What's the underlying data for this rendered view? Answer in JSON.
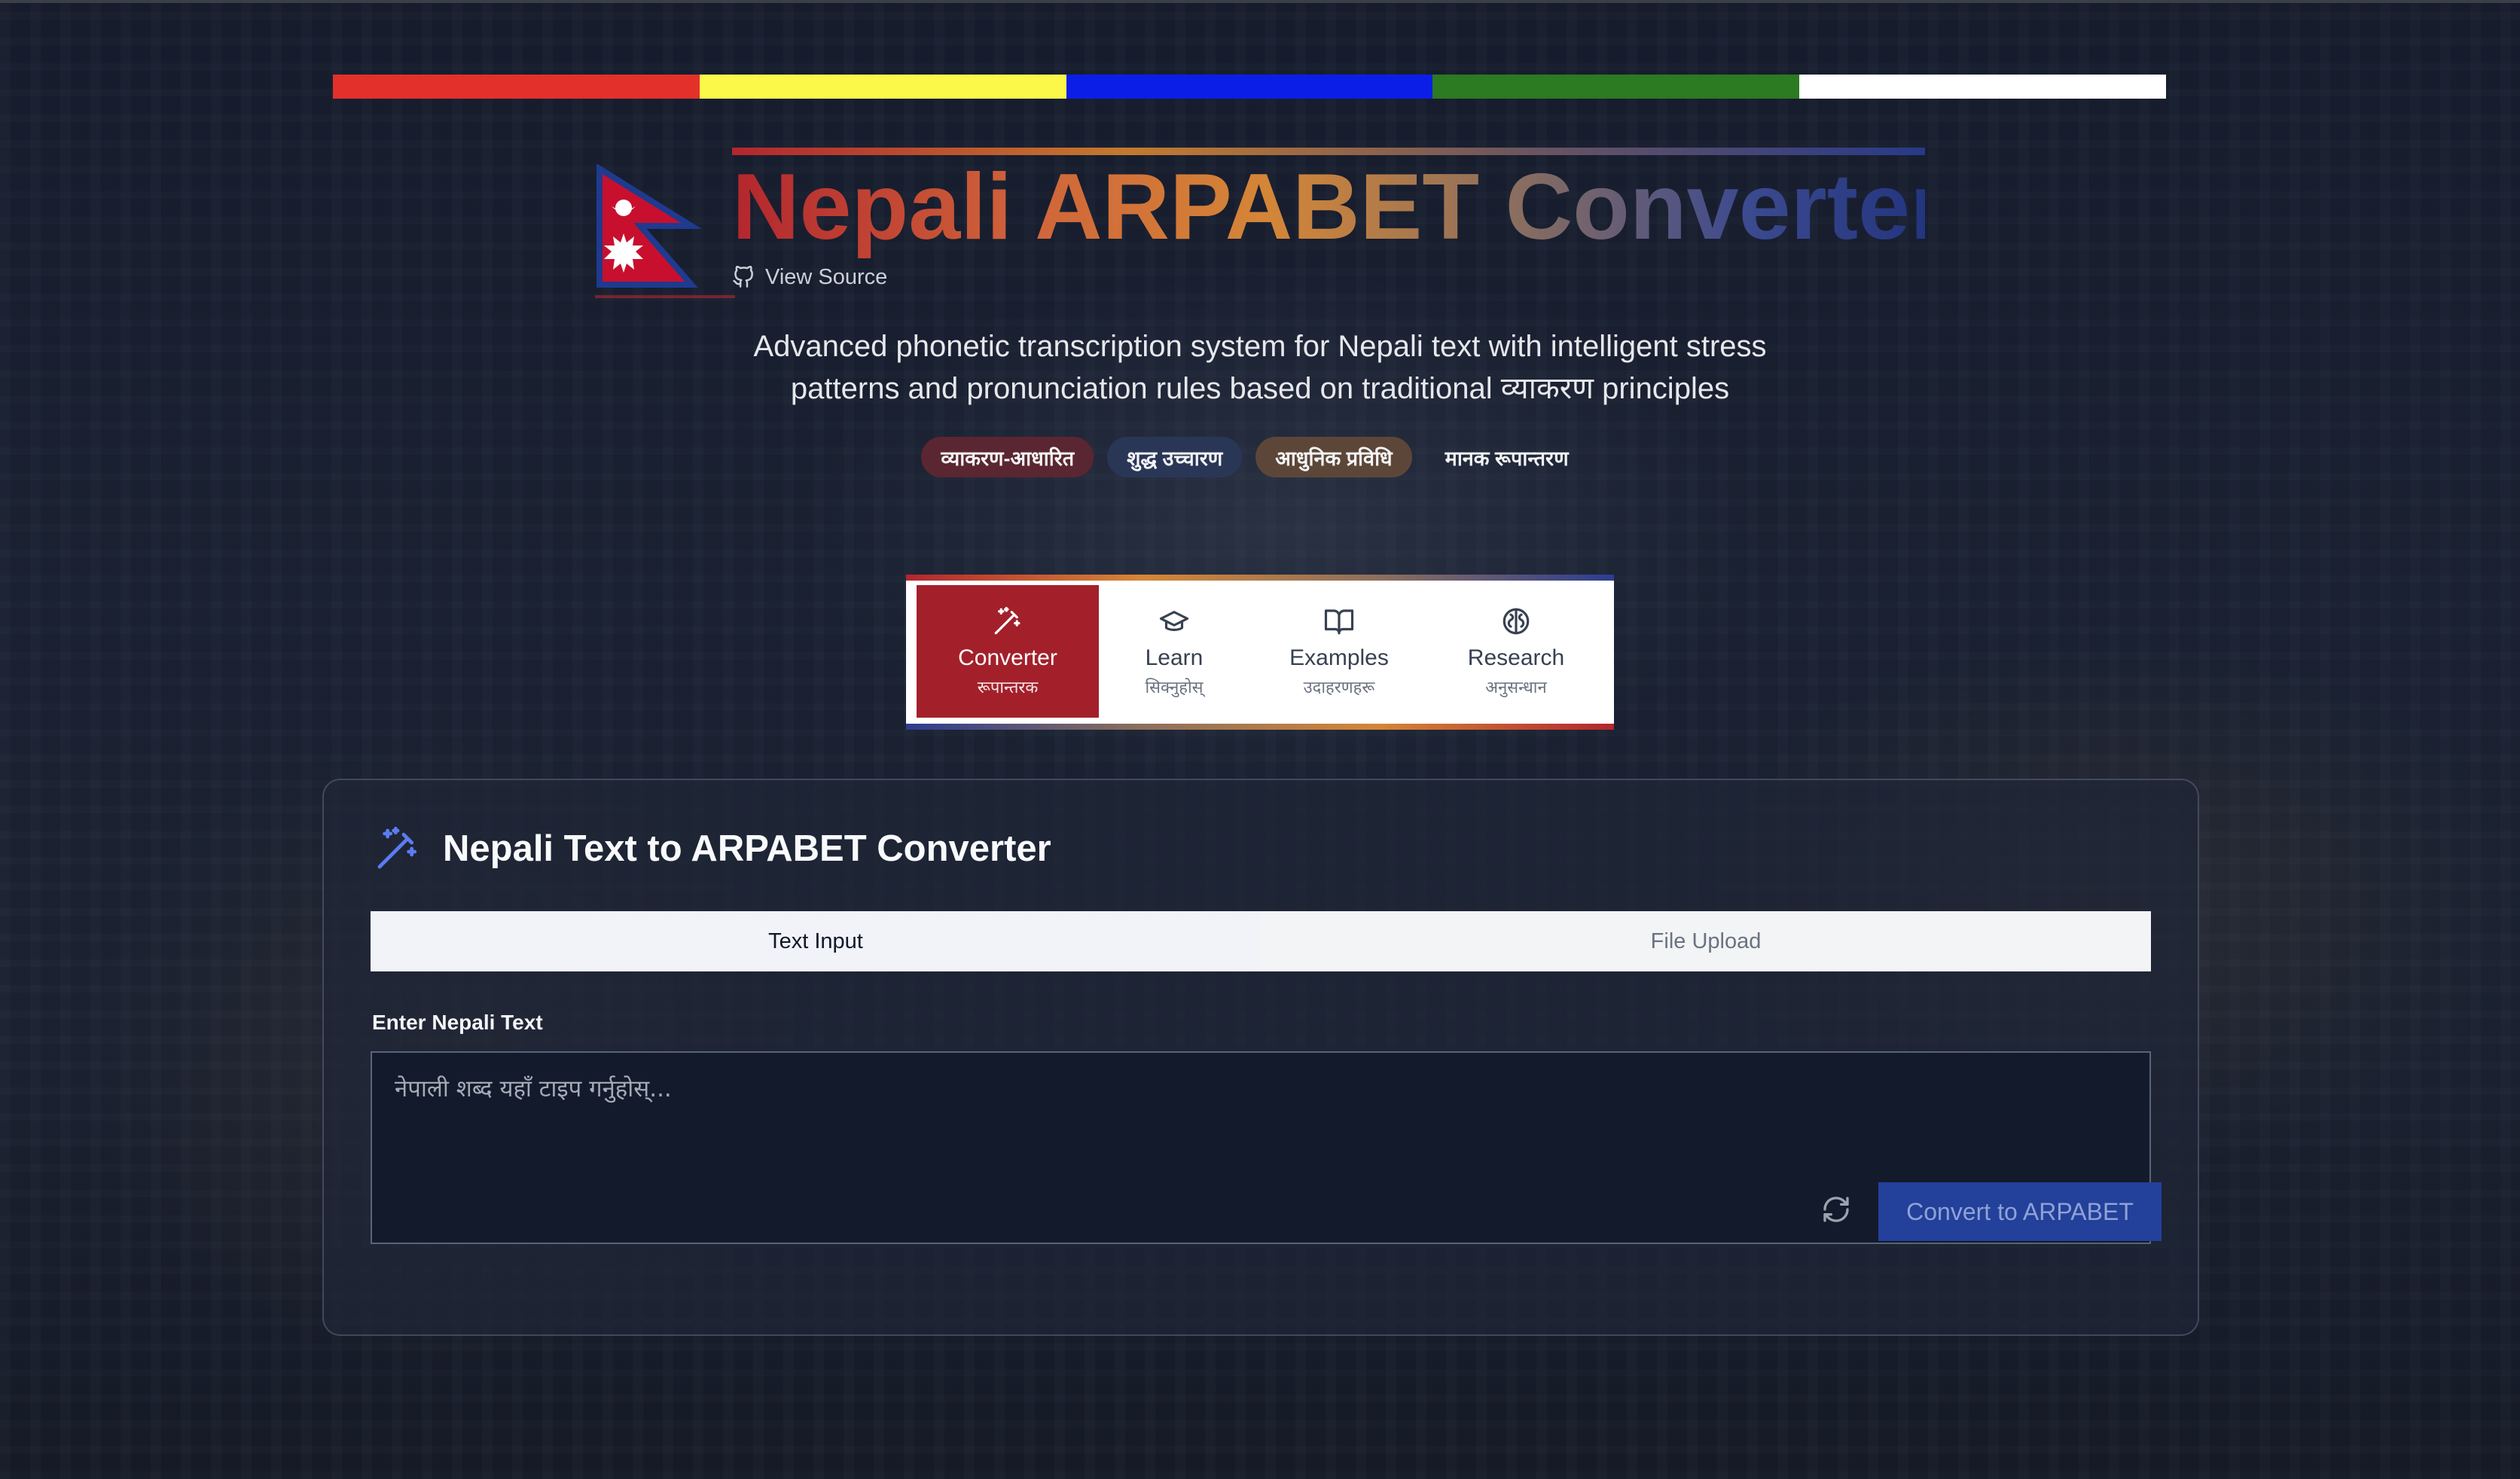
{
  "colors": {
    "flag_red": "#dc3126",
    "flag_yellow": "#fbf74a",
    "flag_blue": "#0a1fe6",
    "flag_green": "#2a7a1f",
    "flag_white": "#ffffff",
    "crimson": "#a3202b",
    "navy": "#23409a"
  },
  "flag_stripes": [
    "#e3302a",
    "#fcf84a",
    "#0b1ee8",
    "#2c7a21",
    "#ffffff"
  ],
  "header": {
    "logo_icon": "nepal-flag-icon",
    "title": "Nepali ARPABET Converter",
    "view_source_icon": "github-icon",
    "view_source_label": "View Source",
    "subtitle_line1": "Advanced phonetic transcription system for Nepali text with intelligent stress",
    "subtitle_line2": "patterns and pronunciation rules based on traditional व्याकरण principles"
  },
  "badges": [
    {
      "label": "व्याकरण-आधारित",
      "bg": "#5a2631"
    },
    {
      "label": "शुद्ध उच्चारण",
      "bg": "#2a3656"
    },
    {
      "label": "आधुनिक प्रविधि",
      "bg": "#5c4638"
    },
    {
      "label": "मानक रूपान्तरण",
      "bg": "rgba(0,0,0,0)"
    }
  ],
  "nav": {
    "items": [
      {
        "label": "Converter",
        "sub": "रूपान्तरक",
        "icon": "magic-wand-icon"
      },
      {
        "label": "Learn",
        "sub": "सिक्नुहोस्",
        "icon": "graduation-cap-icon"
      },
      {
        "label": "Examples",
        "sub": "उदाहरणहरू",
        "icon": "book-open-icon"
      },
      {
        "label": "Research",
        "sub": "अनुसन्धान",
        "icon": "brain-icon"
      }
    ],
    "active": "Converter"
  },
  "converter": {
    "title_icon": "magic-wand-icon",
    "title": "Nepali Text to ARPABET Converter",
    "tabs": [
      {
        "label": "Text Input",
        "active": true
      },
      {
        "label": "File Upload",
        "active": false
      }
    ],
    "field_label": "Enter Nepali Text",
    "placeholder": "नेपाली शब्द यहाँ टाइप गर्नुहोस्...",
    "value": "",
    "reset_icon": "refresh-icon",
    "convert_label": "Convert to ARPABET"
  }
}
